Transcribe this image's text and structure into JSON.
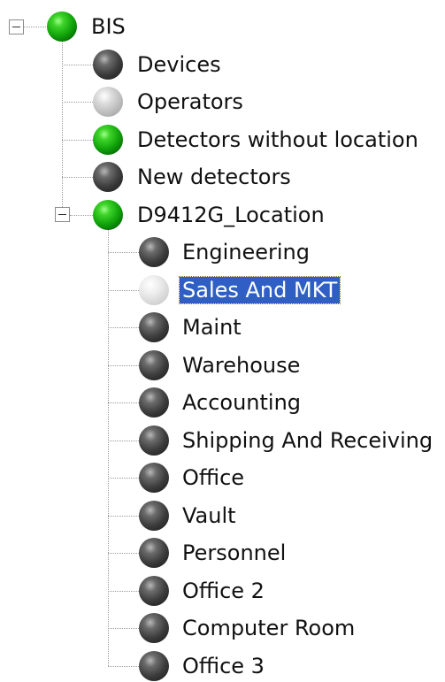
{
  "tree": {
    "root": {
      "label": "BIS",
      "status": "green",
      "expanded": true
    },
    "root_children": [
      {
        "label": "Devices",
        "status": "dark"
      },
      {
        "label": "Operators",
        "status": "light"
      },
      {
        "label": "Detectors without location",
        "status": "green"
      },
      {
        "label": "New detectors",
        "status": "dark"
      }
    ],
    "location": {
      "label": "D9412G_Location",
      "status": "green",
      "expanded": true
    },
    "location_children": [
      {
        "label": "Engineering",
        "status": "dark"
      },
      {
        "label": "Sales And MKT",
        "status": "pale",
        "selected": true
      },
      {
        "label": "Maint",
        "status": "dark"
      },
      {
        "label": "Warehouse",
        "status": "dark"
      },
      {
        "label": "Accounting",
        "status": "dark"
      },
      {
        "label": "Shipping And Receiving",
        "status": "dark"
      },
      {
        "label": "Office",
        "status": "dark"
      },
      {
        "label": "Vault",
        "status": "dark"
      },
      {
        "label": "Personnel",
        "status": "dark"
      },
      {
        "label": "Office 2",
        "status": "dark"
      },
      {
        "label": "Computer Room",
        "status": "dark"
      },
      {
        "label": "Office 3",
        "status": "dark"
      }
    ]
  },
  "colors": {
    "selection": "#2f5fc4",
    "status_green": "#12a60b",
    "status_dark": "#3d3d3d",
    "status_light": "#b3b3b3"
  }
}
